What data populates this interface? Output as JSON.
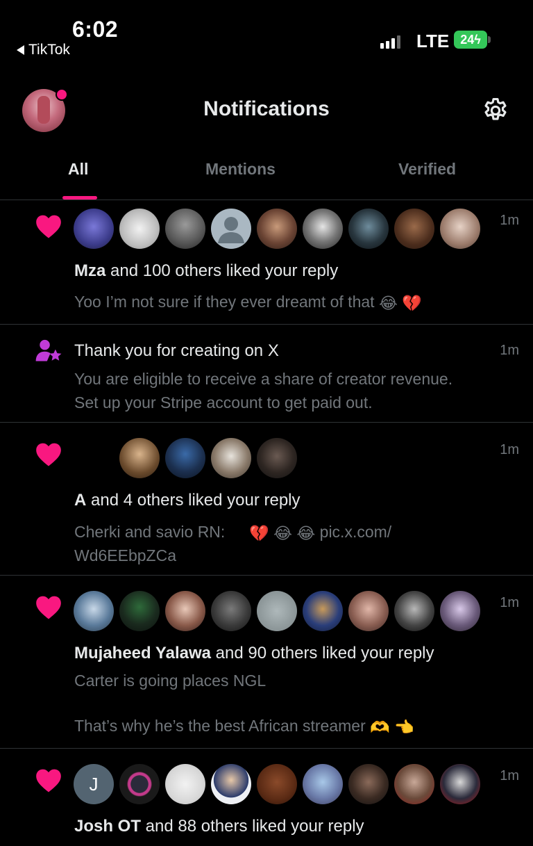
{
  "status_bar": {
    "time": "6:02",
    "back_app": "TikTok",
    "network": "LTE",
    "battery": "24"
  },
  "header": {
    "title": "Notifications",
    "avatar_icon": "profile-avatar",
    "settings_icon": "gear-icon"
  },
  "tabs": [
    {
      "label": "All",
      "active": true
    },
    {
      "label": "Mentions",
      "active": false
    },
    {
      "label": "Verified",
      "active": false
    }
  ],
  "notifications": [
    {
      "type": "like",
      "name": "Mza",
      "rest": " and 100 others liked your reply",
      "sub": "Yoo I’m not sure if they ever dreamt of that",
      "time": "1m"
    },
    {
      "type": "creator",
      "title": "Thank you for creating on X",
      "sub1": "You are eligible to receive a share of creator revenue.",
      "sub2": "Set up your Stripe account to get paid out.",
      "time": "1m"
    },
    {
      "type": "like",
      "name": "A",
      "rest": " and 4 others liked your reply",
      "sub": "Cherki and savio RN:",
      "link": "pic.x.com/",
      "sub2": "Wd6EEbpZCa",
      "time": "1m"
    },
    {
      "type": "like",
      "name": "Mujaheed Yalawa",
      "rest": " and 90 others liked your reply",
      "sub": "Carter is going places NGL",
      "sub2": "That’s why he’s the best African streamer",
      "time": "1m"
    },
    {
      "type": "like",
      "name": "Josh OT",
      "rest": " and 88 others liked your reply",
      "avatar_letter": "J",
      "time": "1m"
    }
  ],
  "colors": {
    "accent": "#f91880",
    "muted": "#71767b",
    "divider": "#2f3336",
    "verified_purple": "#c03bd8"
  }
}
